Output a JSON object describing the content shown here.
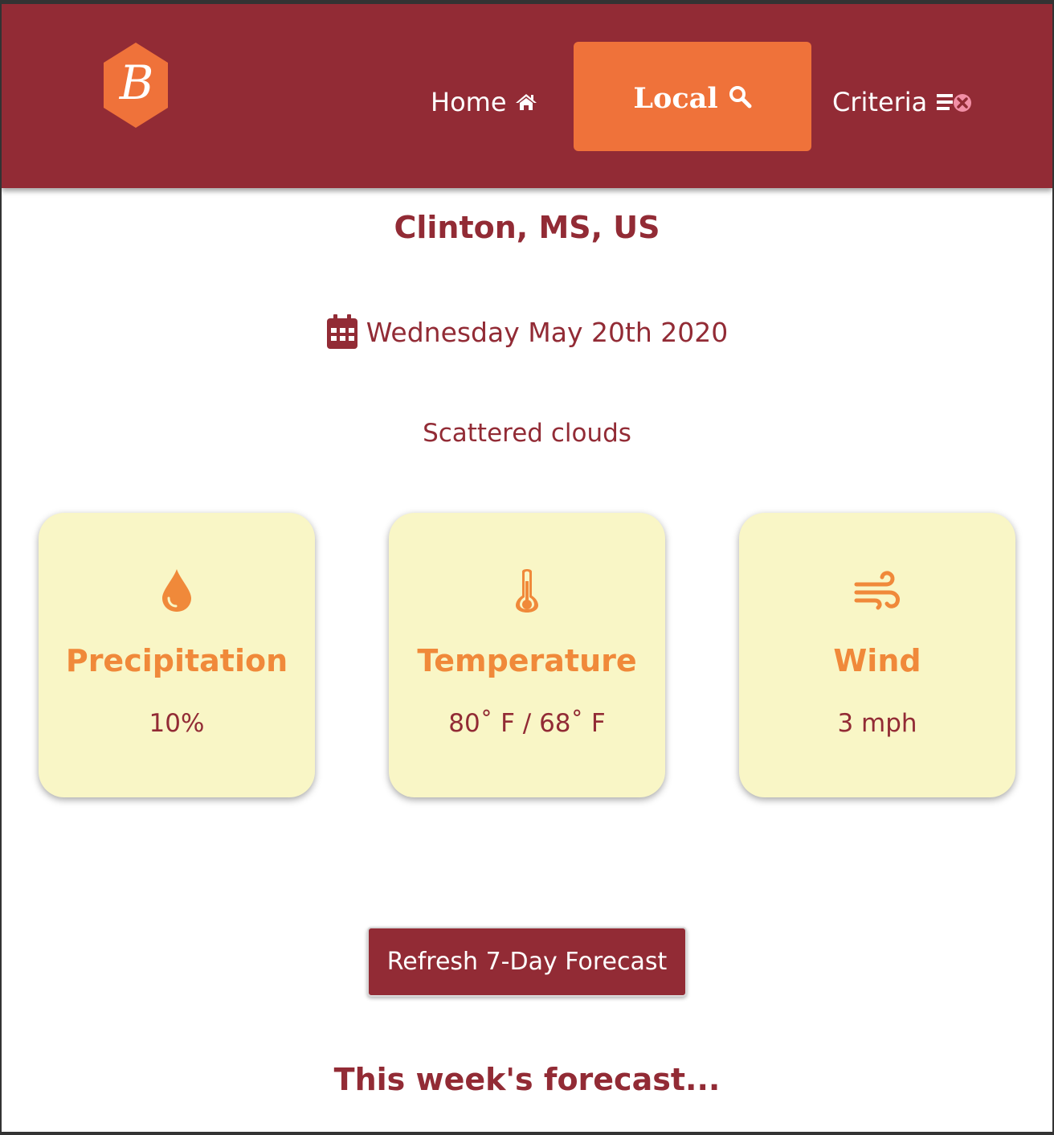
{
  "nav": {
    "logo_letter": "B",
    "home_label": "Home",
    "local_label": "Local",
    "criteria_label": "Criteria",
    "icons": {
      "home": "home-icon",
      "local": "search-icon",
      "criteria": "list-remove-icon"
    }
  },
  "location": {
    "city": "Clinton, MS, US",
    "date": "Wednesday May 20th 2020",
    "date_icon": "calendar-icon",
    "description": "Scattered clouds"
  },
  "cards": [
    {
      "icon": "droplet-icon",
      "title": "Precipitation",
      "value": "10%"
    },
    {
      "icon": "thermometer-icon",
      "title": "Temperature",
      "value": "80˚ F / 68˚ F"
    },
    {
      "icon": "wind-icon",
      "title": "Wind",
      "value": "3 mph"
    }
  ],
  "actions": {
    "refresh_label": "Refresh 7-Day Forecast"
  },
  "forecast": {
    "heading": "This week's forecast..."
  },
  "colors": {
    "header_bg": "#922b35",
    "accent_orange": "#ef723a",
    "card_bg": "#f9f6c6",
    "card_title": "#f0893a",
    "text_primary": "#922b35"
  }
}
